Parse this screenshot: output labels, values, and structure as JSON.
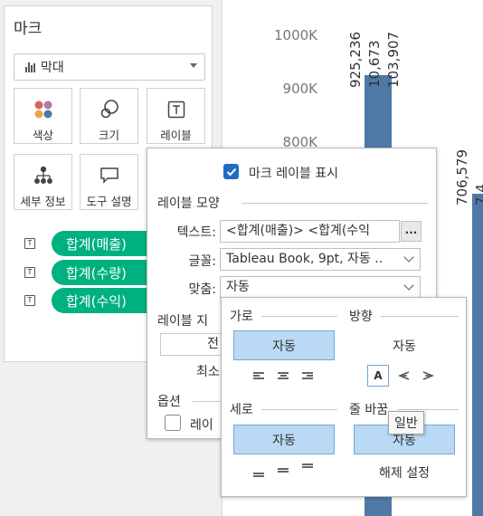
{
  "marks": {
    "title": "마크",
    "mark_type": "막대",
    "tiles": [
      {
        "label": "색상",
        "icon": "color-icon"
      },
      {
        "label": "크기",
        "icon": "size-icon"
      },
      {
        "label": "레이블",
        "icon": "label-icon"
      },
      {
        "label": "세부 정보",
        "icon": "detail-icon"
      },
      {
        "label": "도구 설명",
        "icon": "tooltip-icon"
      }
    ],
    "pills": [
      {
        "label": "합계(매출)",
        "type_icon": "T"
      },
      {
        "label": "합계(수량)",
        "type_icon": "T"
      },
      {
        "label": "합계(수익)",
        "type_icon": "T"
      }
    ]
  },
  "chart": {
    "bar_color": "#4e79a7",
    "axis_ticks": [
      "1000K",
      "900K",
      "800K"
    ],
    "bar1_labels": [
      "925,236",
      "10,673",
      "103,907"
    ],
    "bar2_labels": [
      "706,579",
      "7,4…"
    ]
  },
  "label_popup": {
    "show_labels": "마크 레이블 표시",
    "section_appearance": "레이블 모양",
    "text_label": "텍스트:",
    "text_value": "<합계(매출)> <합계(수익",
    "ellipsis": "...",
    "font_label": "글꼴:",
    "font_value": "Tableau Book, 9pt, 자동 ..",
    "align_label": "맞춤:",
    "align_value": "자동",
    "section_marks": "레이블 지",
    "partial_button": "전",
    "min_label": "최소",
    "section_options": "옵션",
    "option_checkbox": "레이",
    "accent": "#1f6ec1"
  },
  "align_popup": {
    "horizontal": "가로",
    "direction": "방향",
    "horizontal_auto": "자동",
    "direction_auto": "자동",
    "vertical": "세로",
    "wrap": "줄 바꿈",
    "vertical_auto": "자동",
    "wrap_auto": "자동",
    "unwrap": "해제 설정",
    "tooltip": "일반",
    "dir_letter": "A",
    "selected_color": "#b9d9f5"
  }
}
